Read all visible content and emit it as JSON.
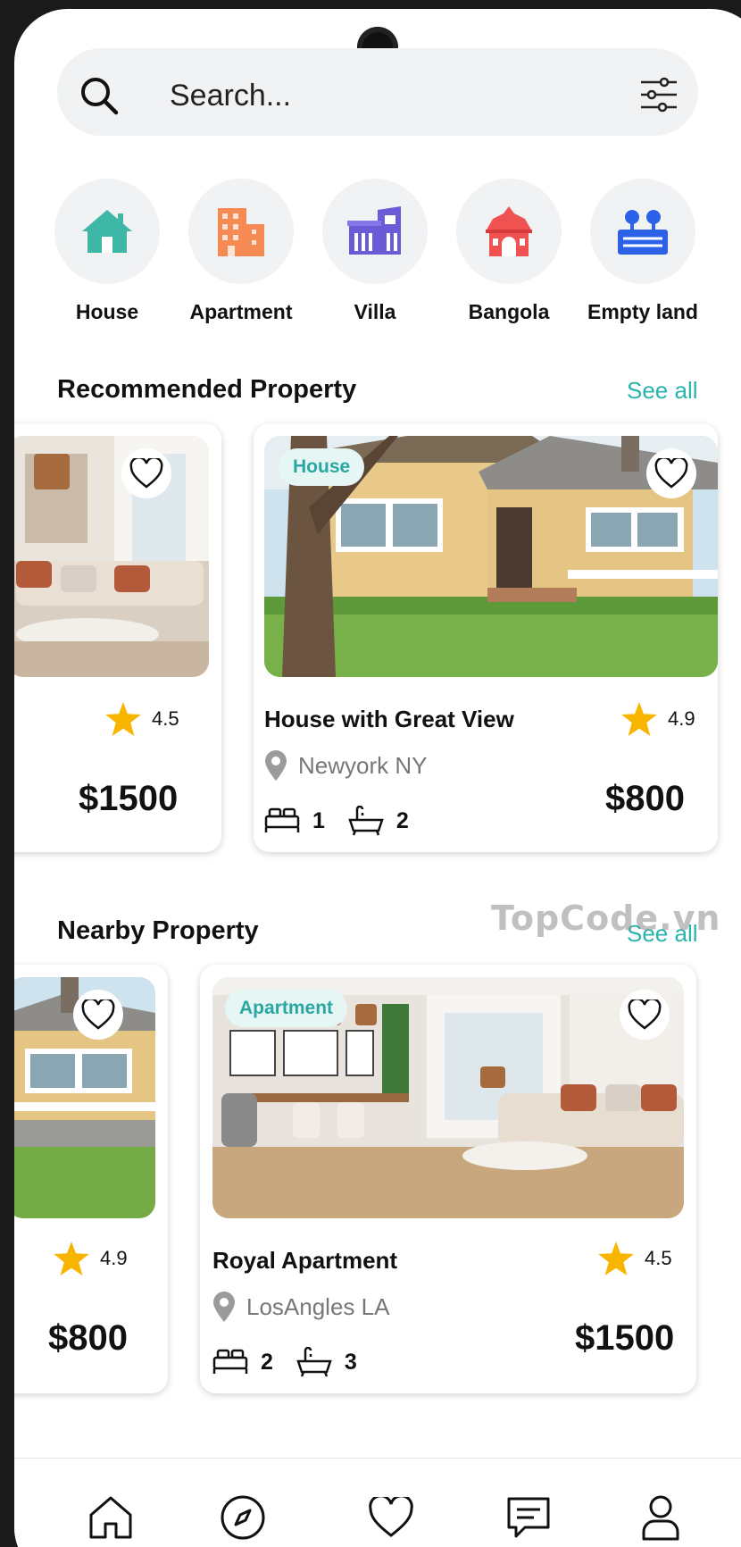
{
  "search": {
    "placeholder": "Search..."
  },
  "categories": [
    {
      "label": "House",
      "icon": "house-icon",
      "color": "#3fb7a7"
    },
    {
      "label": "Apartment",
      "icon": "apartment-building-icon",
      "color": "#f58a55"
    },
    {
      "label": "Villa",
      "icon": "villa-icon",
      "color": "#6a5bd6"
    },
    {
      "label": "Bangola",
      "icon": "bangola-icon",
      "color": "#f05151"
    },
    {
      "label": "Empty land",
      "icon": "empty-land-icon",
      "color": "#2c61e8"
    }
  ],
  "recommended": {
    "title": "Recommended Property",
    "see_all": "See all",
    "cards": [
      {
        "tag": "",
        "title": "",
        "location": "",
        "rating": "4.5",
        "beds": "",
        "baths": "",
        "price": "$1500"
      },
      {
        "tag": "House",
        "title": "House with Great View",
        "location": "Newyork NY",
        "rating": "4.9",
        "beds": "1",
        "baths": "2",
        "price": "$800"
      }
    ]
  },
  "nearby": {
    "title": "Nearby Property",
    "see_all": "See all",
    "cards": [
      {
        "tag": "",
        "title": "",
        "location": "",
        "rating": "4.9",
        "beds": "",
        "baths": "",
        "price": "$800"
      },
      {
        "tag": "Apartment",
        "title": "Royal Apartment",
        "location": "LosAngles LA",
        "rating": "4.5",
        "beds": "2",
        "baths": "3",
        "price": "$1500"
      }
    ]
  },
  "watermark": "TopCode.vn",
  "nav": [
    {
      "icon": "home-icon"
    },
    {
      "icon": "compass-icon"
    },
    {
      "icon": "heart-icon"
    },
    {
      "icon": "chat-icon"
    },
    {
      "icon": "profile-icon"
    }
  ],
  "colors": {
    "accent": "#2bb3ad",
    "star": "#f7b500"
  }
}
